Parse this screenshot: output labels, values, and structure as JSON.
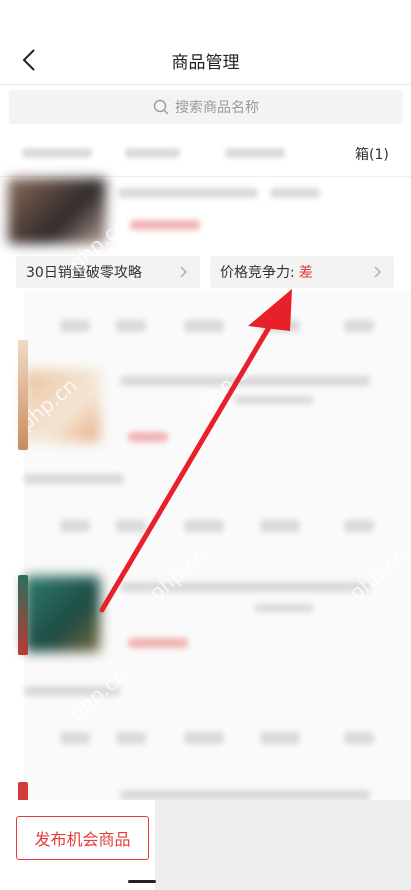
{
  "header": {
    "title": "商品管理"
  },
  "search": {
    "placeholder": "搜索商品名称"
  },
  "tabs": {
    "last_label": "箱(1)"
  },
  "info_cards": {
    "sales_tip": "30日销量破零攻略",
    "price_label": "价格竞争力:",
    "price_value": "差"
  },
  "footer": {
    "publish_label": "发布机会商品"
  },
  "watermark": "php.cn",
  "colors": {
    "accent": "#e43b3b",
    "arrow": "#e8202a"
  }
}
